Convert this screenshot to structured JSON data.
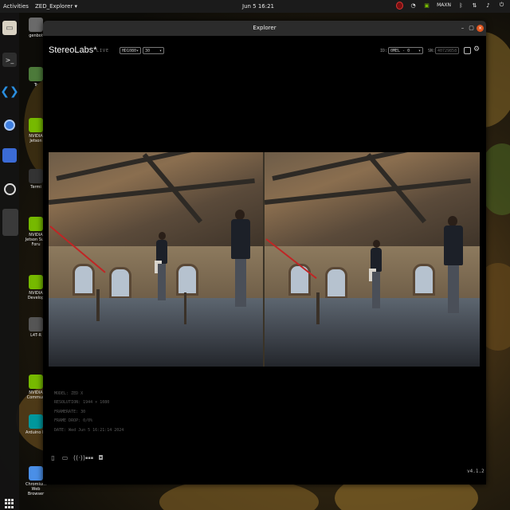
{
  "topbar": {
    "activities": "Activities",
    "app_menu": "ZED_Explorer ▾",
    "clock": "Jun 5  16:21",
    "lang": "MAXN"
  },
  "desktop_icons": [
    {
      "label": "genbot",
      "color": "#6a6a6a"
    },
    {
      "label": "Tr",
      "color": "#4c7a3a"
    },
    {
      "label": "NVIDIA Jetson",
      "color": "#76b900"
    },
    {
      "label": "Termi",
      "color": "#333333"
    },
    {
      "label": "NVIDIA Jetson Sup Foru",
      "color": "#76b900"
    },
    {
      "label": "NVIDIA Develop",
      "color": "#76b900"
    },
    {
      "label": "L4T-R",
      "color": "#555555"
    },
    {
      "label": "NVIDIA Commun",
      "color": "#76b900"
    },
    {
      "label": "Arduino IC",
      "color": "#00979c"
    },
    {
      "label": "Chromium Web Browser",
      "color": "#4a8fe7"
    }
  ],
  "window": {
    "title": "Explorer",
    "brand": "StereoLabs*",
    "live": "LIVE",
    "resolution_select": "HD1080",
    "fps_select": "30",
    "id_label": "ID:",
    "id_select": "0MEL - 0",
    "sn_label": "SN:",
    "sn_value": "40729858"
  },
  "info": {
    "model": "MODEL: ZED X",
    "resolution": "RESOLUTION: 1944 × 1080",
    "framerate": "FRAMERATE: 30",
    "frame_drop": "FRAME DROP: 0/0%",
    "date": "DATE: Wed Jun  5 16:21:14 2024"
  },
  "version": "v4.1.2",
  "colors": {
    "accent_close": "#e0561f",
    "rope": "#c02525",
    "window_bg": "#000000"
  }
}
